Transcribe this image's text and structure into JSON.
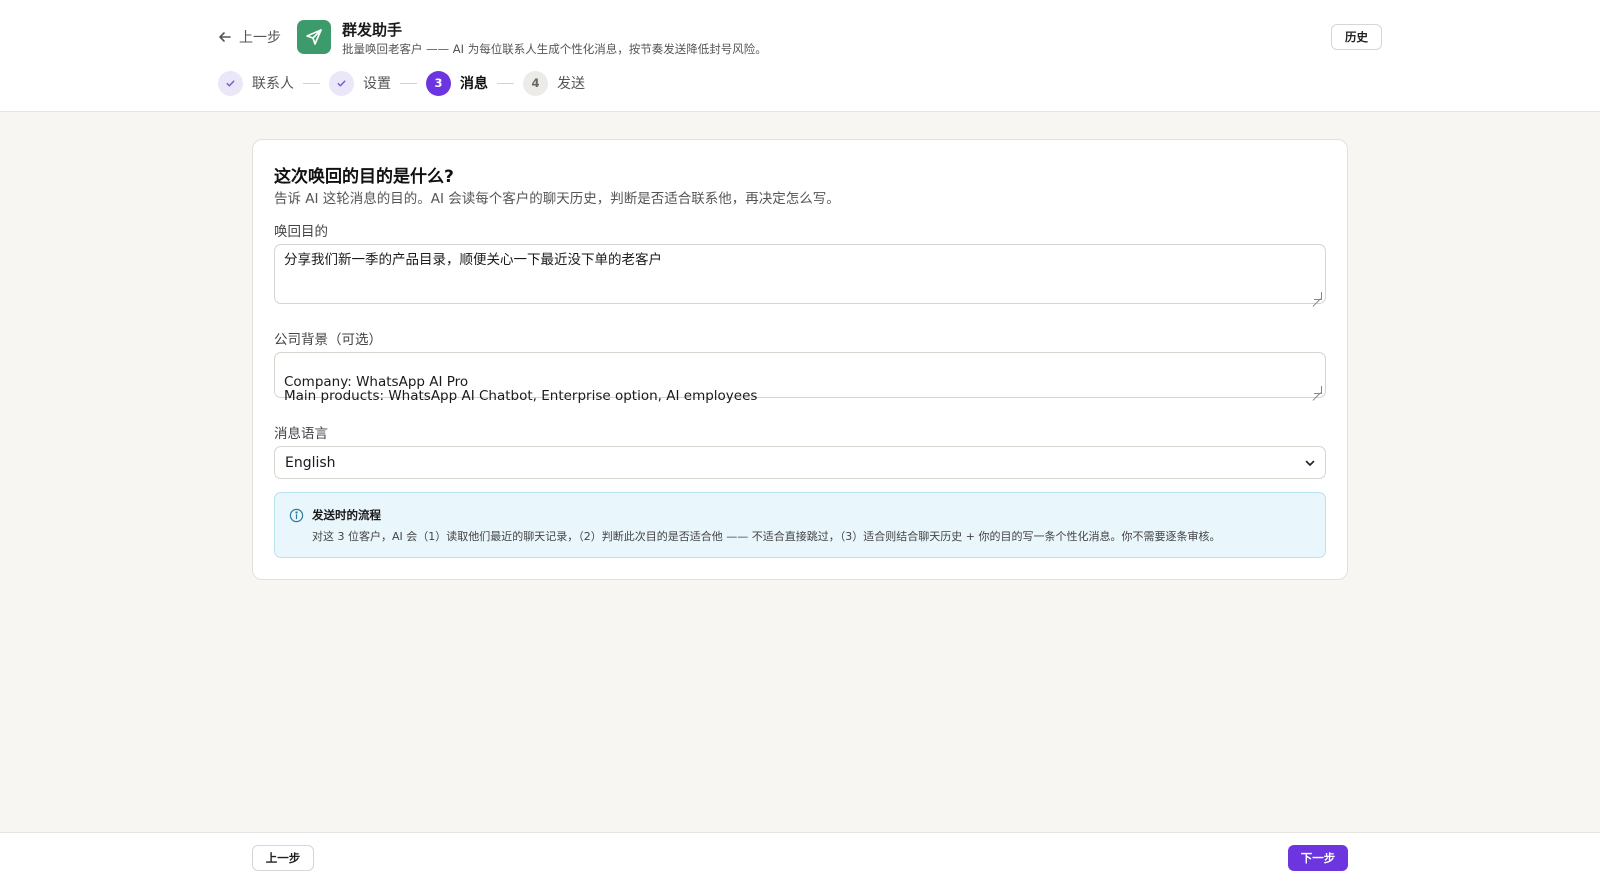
{
  "header": {
    "back_label": "上一步",
    "app_icon": "send-icon",
    "title": "群发助手",
    "subtitle": "批量唤回老客户 —— AI 为每位联系人生成个性化消息，按节奏发送降低封号风险。",
    "history_label": "历史",
    "accent_color": "#3d9a6a"
  },
  "stepper": {
    "steps": [
      {
        "label": "联系人",
        "state": "done",
        "marker": "check-icon"
      },
      {
        "label": "设置",
        "state": "done",
        "marker": "check-icon"
      },
      {
        "label": "消息",
        "state": "active",
        "number": "3"
      },
      {
        "label": "发送",
        "state": "todo",
        "number": "4"
      }
    ],
    "active_color": "#6d35e0"
  },
  "form": {
    "title": "这次唤回的目的是什么?",
    "description": "告诉 AI 这轮消息的目的。AI 会读每个客户的聊天历史，判断是否适合联系他，再决定怎么写。",
    "purpose": {
      "label": "唤回目的",
      "value": "分享我们新一季的产品目录，顺便关心一下最近没下单的老客户"
    },
    "background": {
      "label": "公司背景（可选）",
      "value": "Company: WhatsApp AI Pro\nMain products: WhatsApp AI Chatbot, Enterprise option, AI employees"
    },
    "language": {
      "label": "消息语言",
      "selected": "English"
    },
    "info": {
      "icon": "info-icon",
      "title": "发送时的流程",
      "text": "对这 3 位客户，AI 会（1）读取他们最近的聊天记录，（2）判断此次目的是否适合他 —— 不适合直接跳过，（3）适合则结合聊天历史 + 你的目的写一条个性化消息。你不需要逐条审核。"
    }
  },
  "footer": {
    "prev_label": "上一步",
    "next_label": "下一步",
    "primary_color": "#6d35e0"
  }
}
